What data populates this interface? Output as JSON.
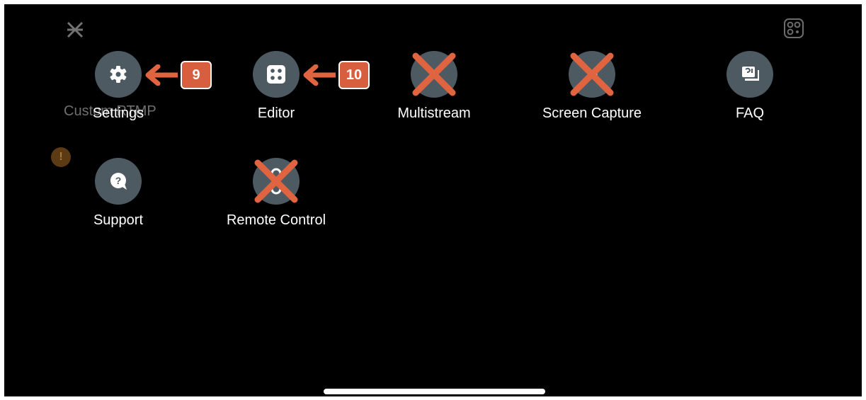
{
  "background": {
    "label": "Custom RTMP",
    "warning_glyph": "!"
  },
  "menu": [
    {
      "label": "Settings",
      "icon": "gear-icon",
      "available": true
    },
    {
      "label": "Editor",
      "icon": "grid-dots-icon",
      "available": true
    },
    {
      "label": "Multistream",
      "icon": "multistream-icon",
      "available": false
    },
    {
      "label": "Screen Capture",
      "icon": "screen-capture-icon",
      "available": false
    },
    {
      "label": "FAQ",
      "icon": "faq-icon",
      "available": true
    },
    {
      "label": "Support",
      "icon": "question-bubble-icon",
      "available": true
    },
    {
      "label": "Remote Control",
      "icon": "remote-control-icon",
      "available": false
    }
  ],
  "annotations": {
    "badge_settings": "9",
    "badge_editor": "10"
  },
  "colors": {
    "icon_circle": "#4d5a61",
    "annotation": "#d75f3f",
    "background": "#000000",
    "text": "#ffffff"
  }
}
